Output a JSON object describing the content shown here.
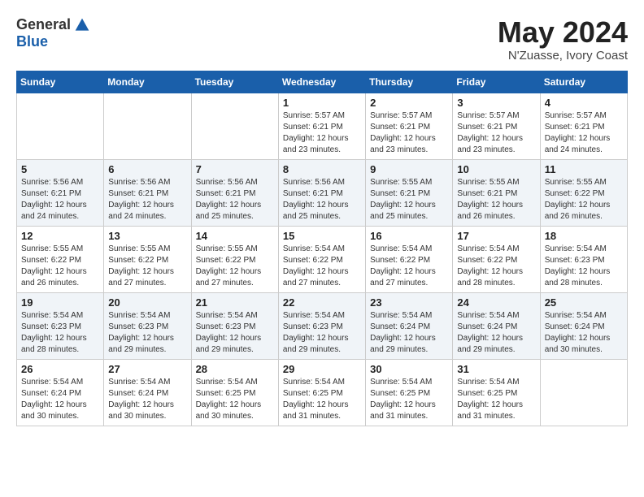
{
  "header": {
    "logo": {
      "general": "General",
      "blue": "Blue"
    },
    "title": "May 2024",
    "location": "N'Zuasse, Ivory Coast"
  },
  "calendar": {
    "days_of_week": [
      "Sunday",
      "Monday",
      "Tuesday",
      "Wednesday",
      "Thursday",
      "Friday",
      "Saturday"
    ],
    "weeks": [
      [
        {
          "day": "",
          "info": ""
        },
        {
          "day": "",
          "info": ""
        },
        {
          "day": "",
          "info": ""
        },
        {
          "day": "1",
          "info": "Sunrise: 5:57 AM\nSunset: 6:21 PM\nDaylight: 12 hours\nand 23 minutes."
        },
        {
          "day": "2",
          "info": "Sunrise: 5:57 AM\nSunset: 6:21 PM\nDaylight: 12 hours\nand 23 minutes."
        },
        {
          "day": "3",
          "info": "Sunrise: 5:57 AM\nSunset: 6:21 PM\nDaylight: 12 hours\nand 23 minutes."
        },
        {
          "day": "4",
          "info": "Sunrise: 5:57 AM\nSunset: 6:21 PM\nDaylight: 12 hours\nand 24 minutes."
        }
      ],
      [
        {
          "day": "5",
          "info": "Sunrise: 5:56 AM\nSunset: 6:21 PM\nDaylight: 12 hours\nand 24 minutes."
        },
        {
          "day": "6",
          "info": "Sunrise: 5:56 AM\nSunset: 6:21 PM\nDaylight: 12 hours\nand 24 minutes."
        },
        {
          "day": "7",
          "info": "Sunrise: 5:56 AM\nSunset: 6:21 PM\nDaylight: 12 hours\nand 25 minutes."
        },
        {
          "day": "8",
          "info": "Sunrise: 5:56 AM\nSunset: 6:21 PM\nDaylight: 12 hours\nand 25 minutes."
        },
        {
          "day": "9",
          "info": "Sunrise: 5:55 AM\nSunset: 6:21 PM\nDaylight: 12 hours\nand 25 minutes."
        },
        {
          "day": "10",
          "info": "Sunrise: 5:55 AM\nSunset: 6:21 PM\nDaylight: 12 hours\nand 26 minutes."
        },
        {
          "day": "11",
          "info": "Sunrise: 5:55 AM\nSunset: 6:22 PM\nDaylight: 12 hours\nand 26 minutes."
        }
      ],
      [
        {
          "day": "12",
          "info": "Sunrise: 5:55 AM\nSunset: 6:22 PM\nDaylight: 12 hours\nand 26 minutes."
        },
        {
          "day": "13",
          "info": "Sunrise: 5:55 AM\nSunset: 6:22 PM\nDaylight: 12 hours\nand 27 minutes."
        },
        {
          "day": "14",
          "info": "Sunrise: 5:55 AM\nSunset: 6:22 PM\nDaylight: 12 hours\nand 27 minutes."
        },
        {
          "day": "15",
          "info": "Sunrise: 5:54 AM\nSunset: 6:22 PM\nDaylight: 12 hours\nand 27 minutes."
        },
        {
          "day": "16",
          "info": "Sunrise: 5:54 AM\nSunset: 6:22 PM\nDaylight: 12 hours\nand 27 minutes."
        },
        {
          "day": "17",
          "info": "Sunrise: 5:54 AM\nSunset: 6:22 PM\nDaylight: 12 hours\nand 28 minutes."
        },
        {
          "day": "18",
          "info": "Sunrise: 5:54 AM\nSunset: 6:23 PM\nDaylight: 12 hours\nand 28 minutes."
        }
      ],
      [
        {
          "day": "19",
          "info": "Sunrise: 5:54 AM\nSunset: 6:23 PM\nDaylight: 12 hours\nand 28 minutes."
        },
        {
          "day": "20",
          "info": "Sunrise: 5:54 AM\nSunset: 6:23 PM\nDaylight: 12 hours\nand 29 minutes."
        },
        {
          "day": "21",
          "info": "Sunrise: 5:54 AM\nSunset: 6:23 PM\nDaylight: 12 hours\nand 29 minutes."
        },
        {
          "day": "22",
          "info": "Sunrise: 5:54 AM\nSunset: 6:23 PM\nDaylight: 12 hours\nand 29 minutes."
        },
        {
          "day": "23",
          "info": "Sunrise: 5:54 AM\nSunset: 6:24 PM\nDaylight: 12 hours\nand 29 minutes."
        },
        {
          "day": "24",
          "info": "Sunrise: 5:54 AM\nSunset: 6:24 PM\nDaylight: 12 hours\nand 29 minutes."
        },
        {
          "day": "25",
          "info": "Sunrise: 5:54 AM\nSunset: 6:24 PM\nDaylight: 12 hours\nand 30 minutes."
        }
      ],
      [
        {
          "day": "26",
          "info": "Sunrise: 5:54 AM\nSunset: 6:24 PM\nDaylight: 12 hours\nand 30 minutes."
        },
        {
          "day": "27",
          "info": "Sunrise: 5:54 AM\nSunset: 6:24 PM\nDaylight: 12 hours\nand 30 minutes."
        },
        {
          "day": "28",
          "info": "Sunrise: 5:54 AM\nSunset: 6:25 PM\nDaylight: 12 hours\nand 30 minutes."
        },
        {
          "day": "29",
          "info": "Sunrise: 5:54 AM\nSunset: 6:25 PM\nDaylight: 12 hours\nand 31 minutes."
        },
        {
          "day": "30",
          "info": "Sunrise: 5:54 AM\nSunset: 6:25 PM\nDaylight: 12 hours\nand 31 minutes."
        },
        {
          "day": "31",
          "info": "Sunrise: 5:54 AM\nSunset: 6:25 PM\nDaylight: 12 hours\nand 31 minutes."
        },
        {
          "day": "",
          "info": ""
        }
      ]
    ]
  }
}
